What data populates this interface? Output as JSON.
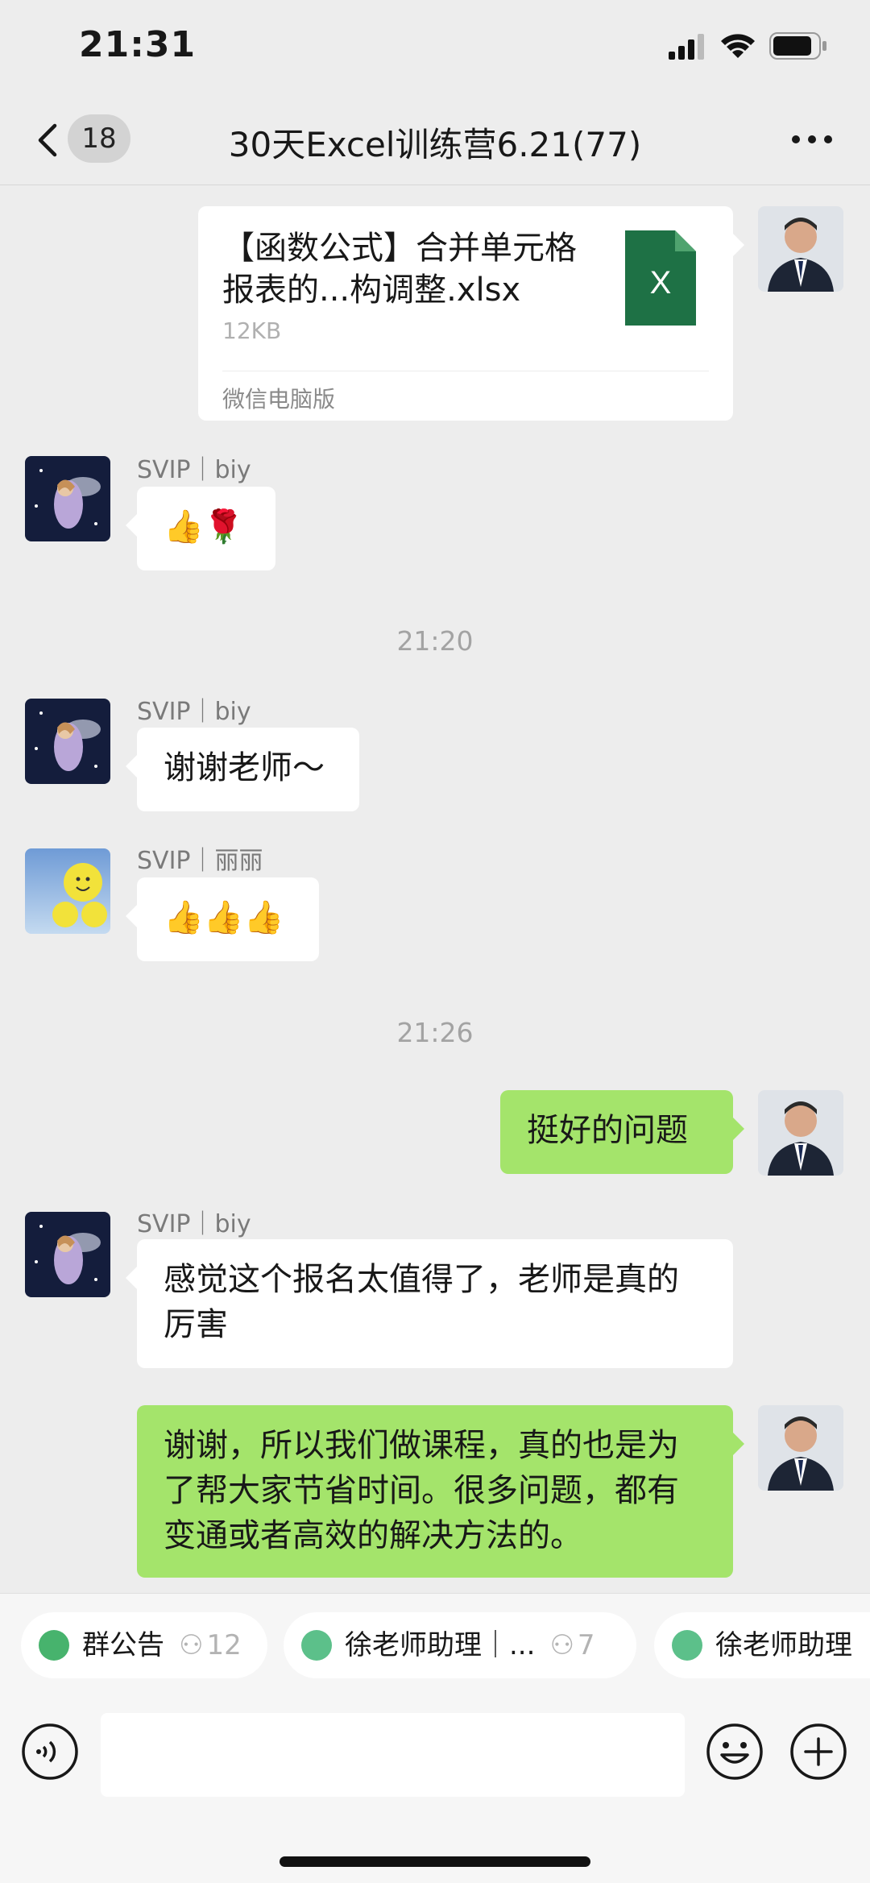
{
  "status": {
    "time": "21:31"
  },
  "nav": {
    "badge": "18",
    "title": "30天Excel训练营6.21(77)"
  },
  "file_msg": {
    "name": "【函数公式】合并单元格报表的...构调整.xlsx",
    "size": "12KB",
    "source": "微信电脑版",
    "icon_letter": "X"
  },
  "messages": [
    {
      "sender": "SVIP｜biy",
      "text": "👍🌹"
    },
    {
      "timestamp": "21:20"
    },
    {
      "sender": "SVIP｜biy",
      "text": "谢谢老师～"
    },
    {
      "sender": "SVIP｜丽丽",
      "text": "👍👍👍"
    },
    {
      "timestamp": "21:26"
    },
    {
      "text": "挺好的问题"
    },
    {
      "sender": "SVIP｜biy",
      "text": "感觉这个报名太值得了，老师是真的厉害"
    },
    {
      "text": "谢谢，所以我们做课程，真的也是为了帮大家节省时间。很多问题，都有变通或者高效的解决方法的。"
    }
  ],
  "quick_chips": [
    {
      "label": "群公告",
      "count": "12"
    },
    {
      "label": "徐老师助理｜...",
      "count": "7"
    },
    {
      "label": "徐老师助理"
    }
  ],
  "input": {
    "placeholder": ""
  },
  "colors": {
    "bubble_mine": "#a4e46b",
    "background": "#ededed",
    "excel_green": "#1e7145"
  }
}
